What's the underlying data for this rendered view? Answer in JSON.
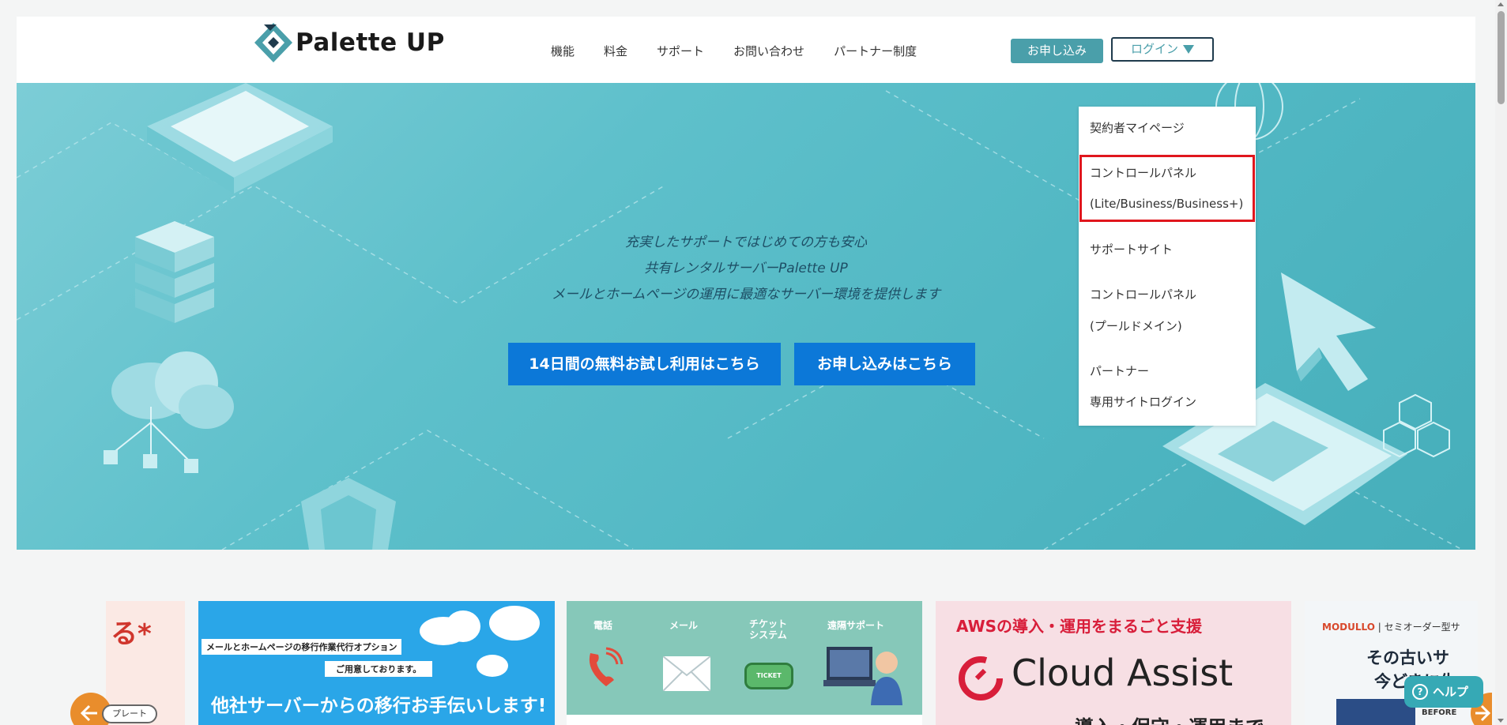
{
  "header": {
    "logo_text": "Palette UP",
    "nav": [
      "機能",
      "料金",
      "サポート",
      "お問い合わせ",
      "パートナー制度"
    ],
    "apply_button": "お申し込み",
    "login_button": "ログイン"
  },
  "hero": {
    "lines": [
      "充実したサポートではじめての方も安心",
      "共有レンタルサーバーPalette UP",
      "メールとホームページの運用に最適なサーバー環境を提供します"
    ],
    "trial_button": "14日間の無料お試し利用はこちら",
    "apply_button": "お申し込みはこちら"
  },
  "login_menu": {
    "items": [
      "契約者マイページ",
      "コントロールパネル",
      "(Lite/Business/Business+)",
      "サポートサイト",
      "コントロールパネル",
      "(プールドメイン)",
      "パートナー",
      "専用サイトログイン"
    ]
  },
  "banners": {
    "left_partial_text": "る*",
    "migrate": {
      "top_label": "メールとホームページの移行作業代行オプション",
      "sub_label": "ご用意しております。",
      "main": "他社サーバーからの移行お手伝いします!"
    },
    "support": {
      "channels": [
        "電話",
        "メール",
        "チケット\nシステム",
        "遠隔サポート"
      ],
      "ticket_text": "TICKET"
    },
    "aws": {
      "headline": "AWSの導入・運用をまるごと支援",
      "brand": "Cloud Assist",
      "sub": "導入・保守・運用まで"
    },
    "modullo": {
      "brand": "MODULLO",
      "tag": "セミオーダー型サ",
      "headline1": "その古いサ",
      "headline2": "今どきに生",
      "before_label": "BEFORE"
    }
  },
  "carousel": {
    "tab_label": "プレート"
  },
  "help": {
    "label": "ヘルプ",
    "icon_glyph": "?"
  },
  "colors": {
    "accent_teal": "#4a9faa",
    "hero_button_blue": "#0c78d8",
    "highlight_red": "#e0161d",
    "carousel_orange": "#e98d2c"
  }
}
